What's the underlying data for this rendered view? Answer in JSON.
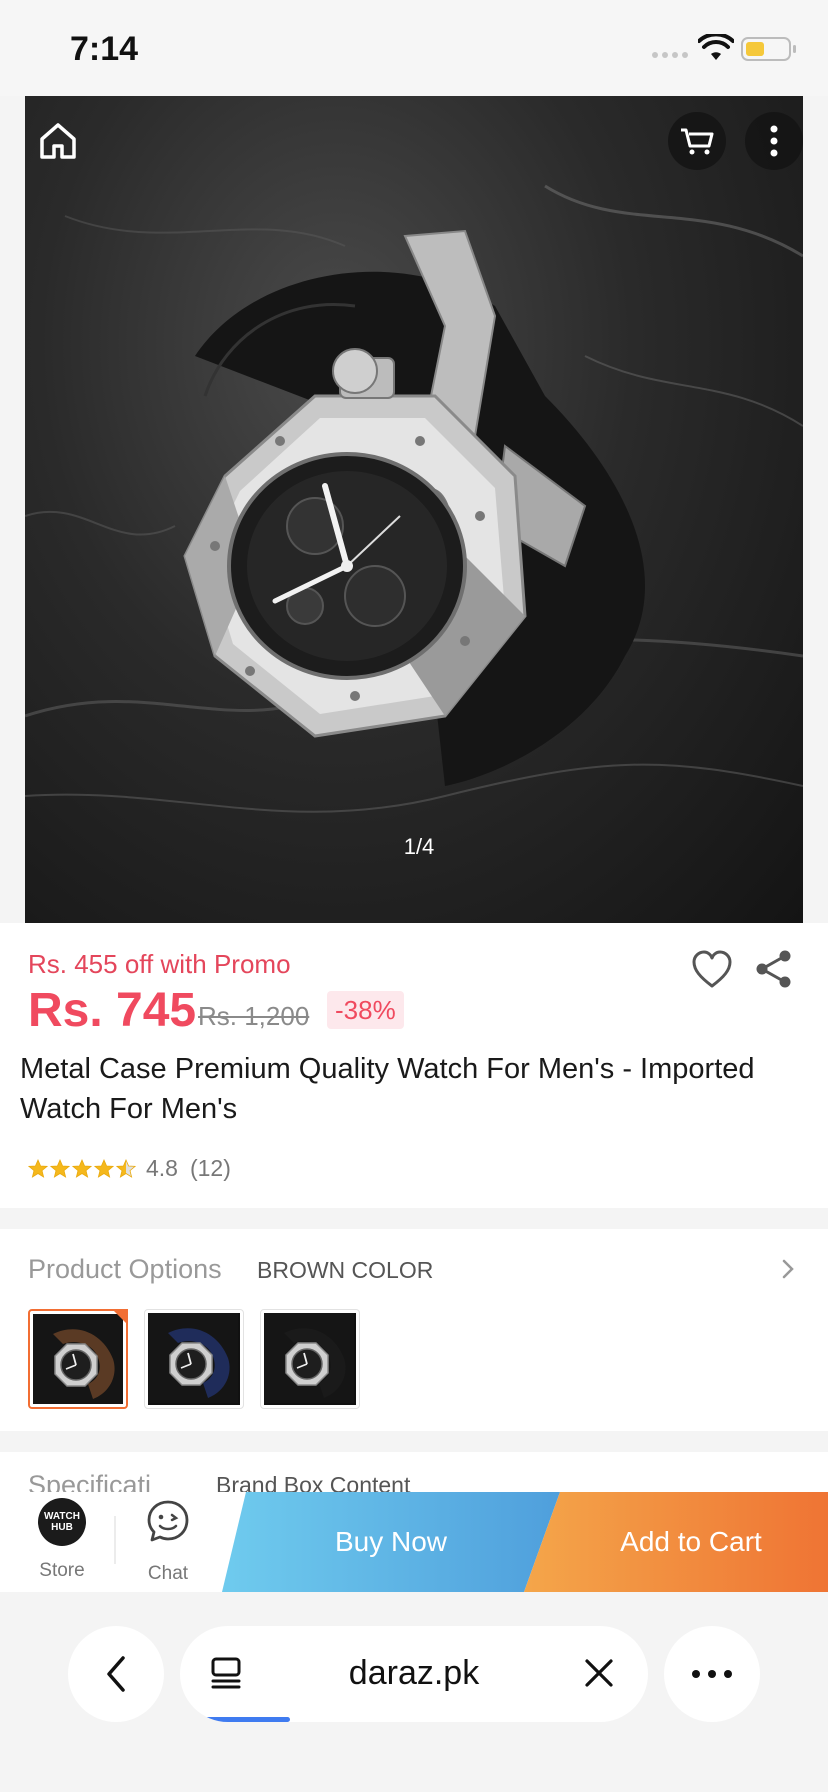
{
  "status_bar": {
    "time": "7:14"
  },
  "gallery": {
    "page_indicator": "1/4"
  },
  "product": {
    "promo_text": "Rs. 455 off with Promo",
    "price": "Rs. 745",
    "original_price": "Rs. 1,200",
    "discount": "-38%",
    "title": "Metal Case Premium Quality Watch For Men's - Imported Watch For Men's",
    "rating_value": "4.8",
    "rating_count": "(12)",
    "rating_stars": 4.5
  },
  "options": {
    "label": "Product Options",
    "selected_value": "BROWN COLOR",
    "thumbnails": [
      {
        "name": "brown-variant",
        "strap_color": "#5a3a24"
      },
      {
        "name": "blue-variant",
        "strap_color": "#1f2c5a"
      },
      {
        "name": "black-variant",
        "strap_color": "#1a1a1a"
      }
    ]
  },
  "specifications": {
    "label": "Specificati",
    "value": "Brand  Box Content"
  },
  "action_bar": {
    "store_label": "Store",
    "store_logo_text": "WATCH HUB",
    "chat_label": "Chat",
    "buy_now": "Buy Now",
    "add_to_cart": "Add to Cart"
  },
  "browser": {
    "url": "daraz.pk"
  },
  "colors": {
    "price_red": "#f04a5f",
    "buy_blue": "#4f9fdc",
    "cart_orange": "#ef7434",
    "selected_orange": "#f26e33"
  },
  "icons": [
    "home-icon",
    "cart-icon",
    "more-icon",
    "heart-icon",
    "share-icon",
    "chevron-right-icon",
    "chat-icon",
    "back-icon",
    "tabs-icon",
    "close-icon",
    "ellipsis-icon"
  ]
}
